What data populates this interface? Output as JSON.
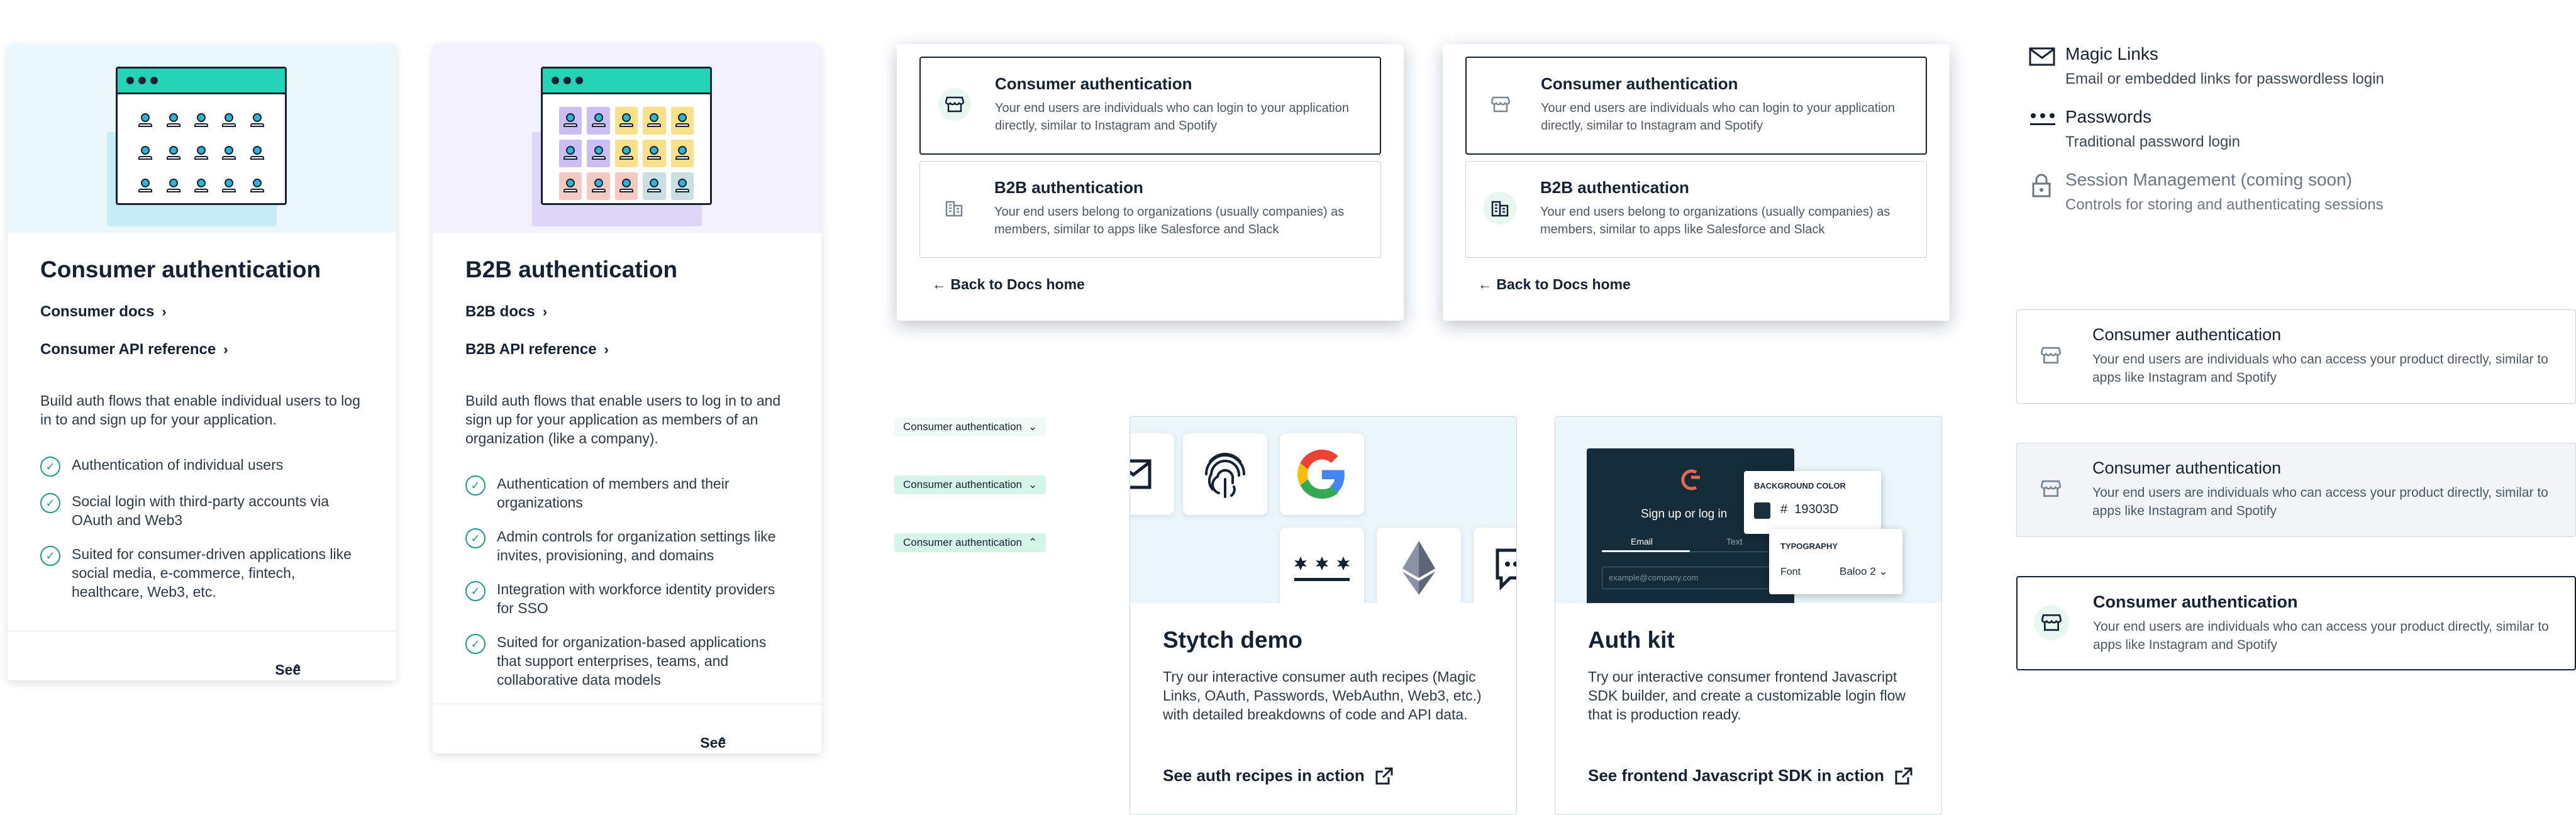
{
  "consumer_card": {
    "title": "Consumer authentication",
    "links": [
      "Consumer docs",
      "Consumer API reference"
    ],
    "description": "Build auth flows that enable individual users to log in to and sign up for your application.",
    "bullets": [
      "Authentication of individual users",
      "Social login with third-party accounts via OAuth and Web3",
      "Suited for consumer-driven applications like social media, e-commerce, fintech, healthcare, Web3, etc."
    ],
    "footer": "See less"
  },
  "b2b_card": {
    "title": "B2B authentication",
    "links": [
      "B2B docs",
      "B2B API reference"
    ],
    "description": "Build auth flows that enable users to log in to and sign up for your application as members of an organization (like a company).",
    "bullets": [
      "Authentication of members and their organizations",
      "Admin controls for organization settings like invites, provisioning, and domains",
      "Integration with workforce identity providers for SSO",
      "Suited for organization-based applications that support enterprises, teams, and collaborative data models"
    ],
    "footer": "See less"
  },
  "selector": {
    "consumer_title": "Consumer authentication",
    "consumer_desc": "Your end users are individuals who can login to your application directly, similar to Instagram and Spotify",
    "b2b_title": "B2B authentication",
    "b2b_desc": "Your end users belong to organizations (usually companies) as members, similar to apps like Salesforce and Slack",
    "back": "Back to Docs home"
  },
  "features": [
    {
      "title": "Magic Links",
      "subtitle": "Email or embedded links for passwordless login"
    },
    {
      "title": "Passwords",
      "subtitle": "Traditional password login"
    },
    {
      "title": "Session Management (coming soon)",
      "subtitle": "Controls for storing and authenticating sessions"
    }
  ],
  "option_variant": {
    "title": "Consumer authentication",
    "desc": "Your end users are individuals who can access your product directly, similar to apps like Instagram and Spotify"
  },
  "pills": [
    "Consumer authentication",
    "Consumer authentication",
    "Consumer authentication"
  ],
  "demo": {
    "title": "Stytch demo",
    "desc": "Try our interactive consumer auth recipes (Magic Links, OAuth, Passwords, WebAuthn, Web3, etc.) with detailed breakdowns of code and API data.",
    "cta": "See auth recipes in action"
  },
  "authkit": {
    "title": "Auth kit",
    "desc": "Try our interactive consumer frontend Javascript SDK builder, and create a customizable login flow that is production ready.",
    "cta": "See frontend Javascript SDK in action",
    "signup": "Sign up or log in",
    "tab_email": "Email",
    "tab_text": "Text",
    "email_placeholder": "example@company.com",
    "bg_label": "BACKGROUND COLOR",
    "bg_hash": "#",
    "bg_value": "19303D",
    "typo_label": "TYPOGRAPHY",
    "font_label": "Font",
    "font_value": "Baloo 2"
  },
  "colors": {
    "accent": "#22d3b5",
    "dark": "#142233",
    "check": "#1a9a8a",
    "bg_dark": "#19303D"
  }
}
